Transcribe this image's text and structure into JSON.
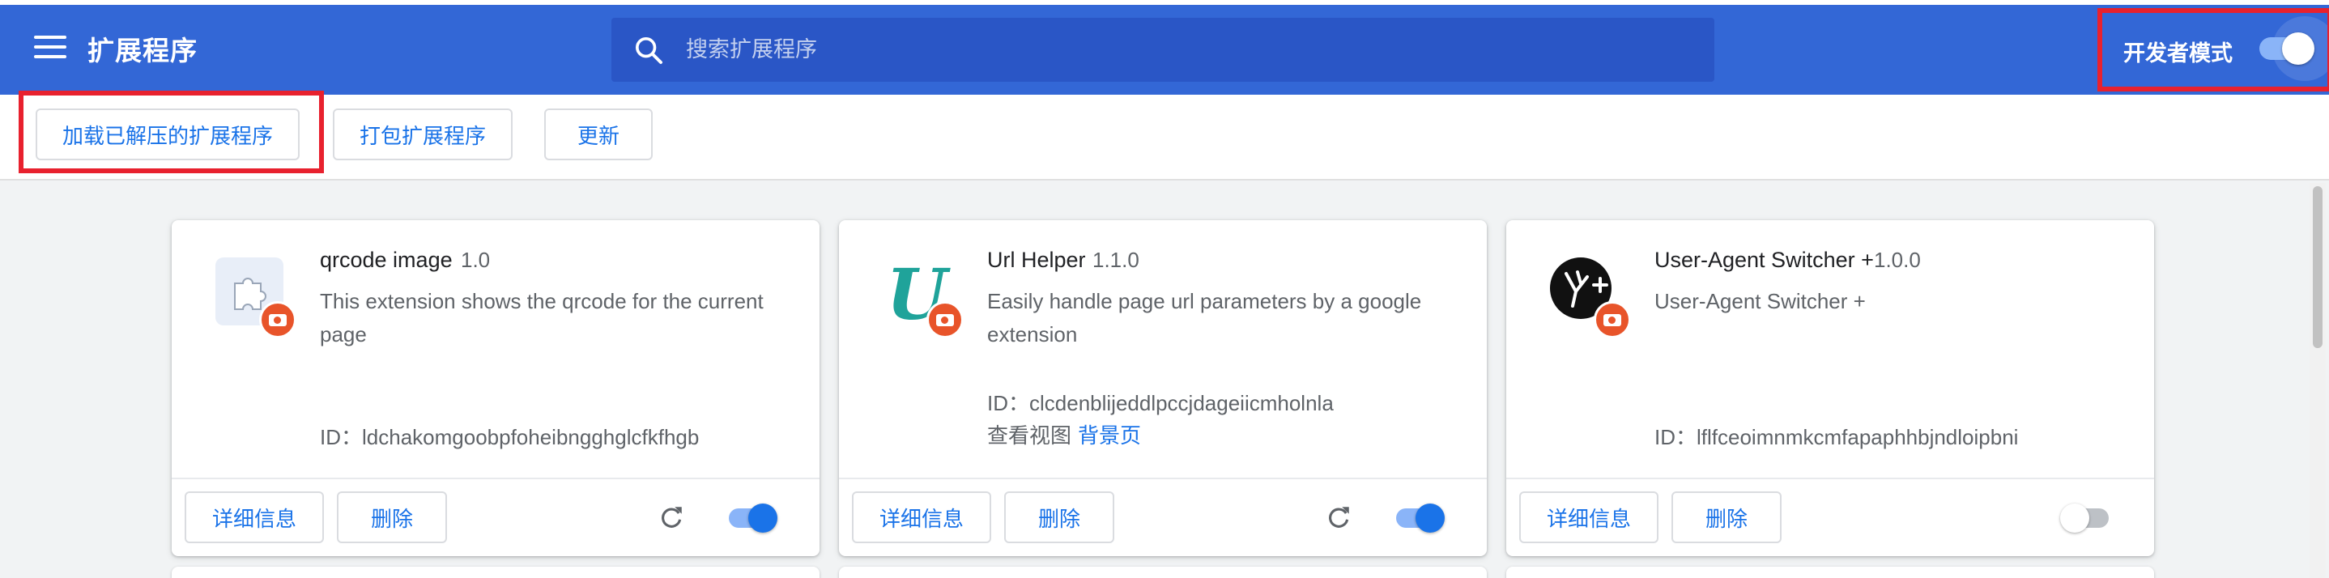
{
  "header": {
    "title": "扩展程序",
    "search_placeholder": "搜索扩展程序",
    "dev_mode_label": "开发者模式",
    "dev_mode_enabled": true,
    "accent_color": "#3367d6"
  },
  "toolbar": {
    "load_unpacked": "加载已解压的扩展程序",
    "pack": "打包扩展程序",
    "update": "更新"
  },
  "extensions": [
    {
      "name": "qrcode image",
      "version": "1.0",
      "description": "This extension shows the qrcode for the current page",
      "id_text": "ID：ldchakomgoobpfoheibngghglcfkfhgb",
      "icon": "puzzle-icon",
      "enabled": true,
      "details": "详细信息",
      "remove": "删除"
    },
    {
      "name": "Url Helper",
      "version": "1.1.0",
      "description": "Easily handle page url parameters by a google extension",
      "id_text": "ID：clcdenblijeddlpccjdageiicmholnla",
      "view_label": "查看视图",
      "view_link": "背景页",
      "icon": "url-helper-u-icon",
      "enabled": true,
      "details": "详细信息",
      "remove": "删除"
    },
    {
      "name": "User-Agent Switcher +",
      "version": "1.0.0",
      "description": "User-Agent Switcher +",
      "id_text": "ID：lflfceoimnmkcmfapaphhbjndloipbni",
      "icon": "user-agent-switcher-icon",
      "enabled": false,
      "details": "详细信息",
      "remove": "删除"
    }
  ]
}
